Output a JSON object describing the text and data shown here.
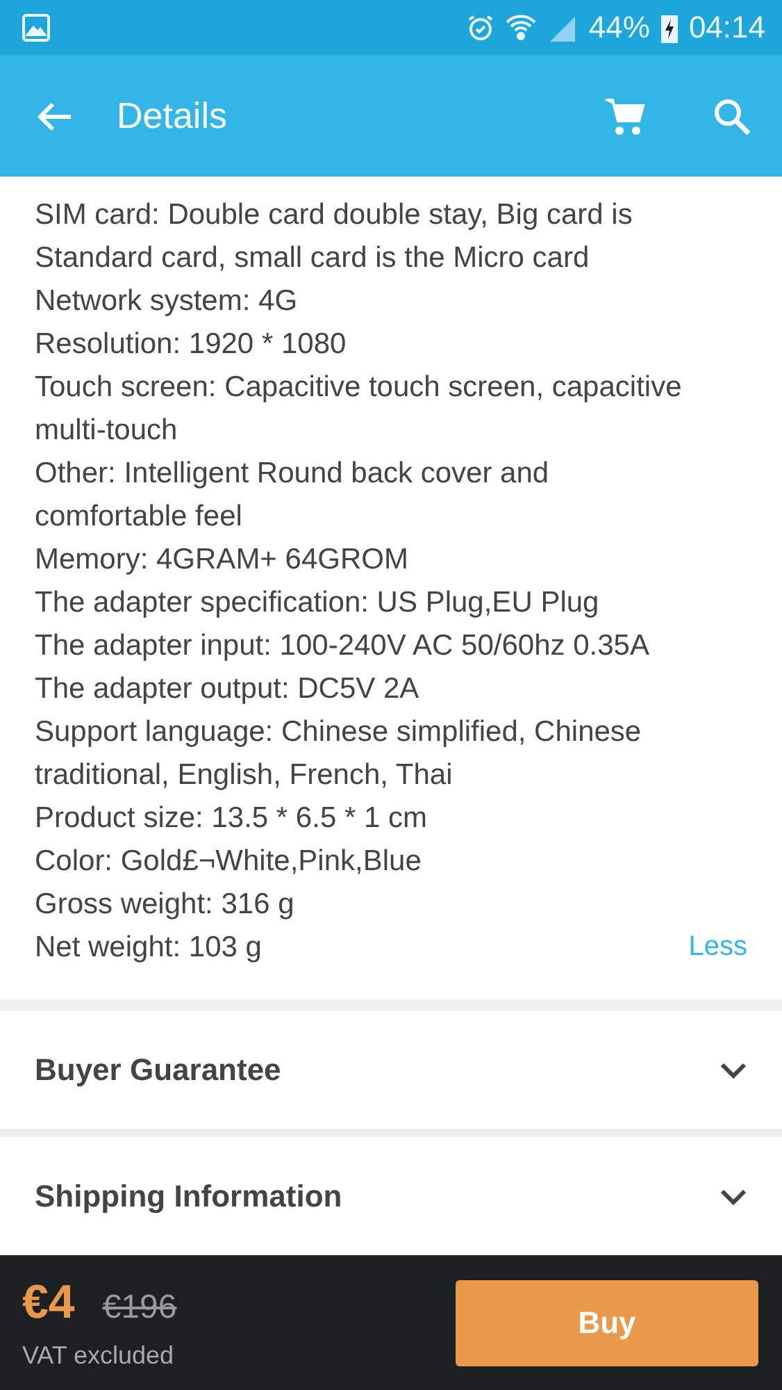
{
  "status_bar": {
    "battery": "44%",
    "time": "04:14"
  },
  "app_bar": {
    "title": "Details"
  },
  "specs": [
    "SIM card: Double card double stay, Big card is Standard card, small card is the Micro card",
    "Network system: 4G",
    "Resolution: 1920 * 1080",
    "Touch screen: Capacitive touch screen, capacitive multi-touch",
    "Other: Intelligent Round back cover and comfortable feel",
    "Memory: 4GRAM+ 64GROM",
    "The adapter specification: US Plug,EU Plug",
    "The adapter input: 100-240V AC 50/60hz 0.35A",
    "The adapter output: DC5V 2A",
    "Support language: Chinese simplified, Chinese traditional, English, French, Thai",
    "Product size: 13.5 * 6.5 * 1 cm",
    "Color: Gold£¬White,Pink,Blue",
    "Gross weight: 316 g",
    "Net weight: 103 g"
  ],
  "less_link": "Less",
  "sections": [
    {
      "title": "Buyer Guarantee",
      "expanded": false
    },
    {
      "title": "Shipping Information",
      "expanded": false
    }
  ],
  "bottom_bar": {
    "price": "€4",
    "old_price": "€196",
    "vat_note": "VAT excluded",
    "buy_button": "Buy"
  }
}
